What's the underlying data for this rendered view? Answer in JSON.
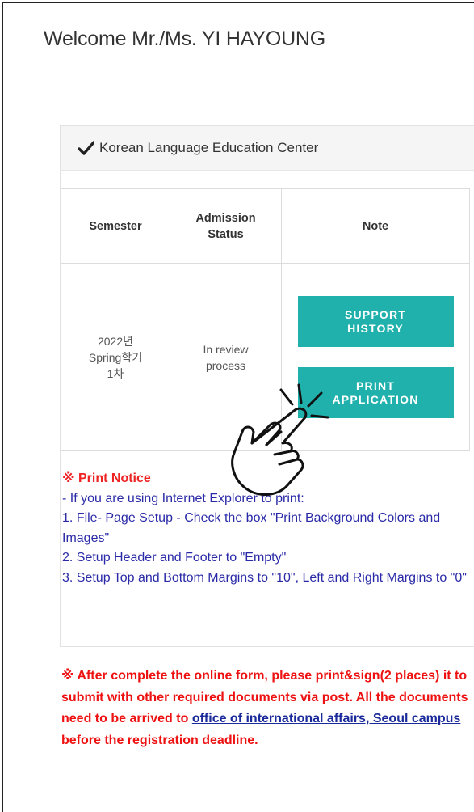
{
  "welcome": "Welcome Mr./Ms. YI HAYOUNG",
  "panel": {
    "title": "Korean Language Education Center",
    "icon": "check-icon"
  },
  "table": {
    "headers": [
      "Semester",
      "Admission Status",
      "Note"
    ],
    "rows": [
      {
        "semester": "2022년 Spring학기 1차",
        "status": "In review process",
        "buttons": [
          "SUPPORT HISTORY",
          "PRINT APPLICATION"
        ]
      }
    ]
  },
  "notice": {
    "title": "※ Print Notice",
    "lines": [
      "- If you are using Internet Explorer to print:",
      "1. File- Page Setup - Check the box \"Print Background Colors and Images\"",
      "2. Setup Header and Footer to \"Empty\"",
      "3. Setup Top and Bottom Margins to \"10\", Left and Right Margins to \"0\""
    ]
  },
  "warning": {
    "before": "※ After complete the online form, please print&sign(2 places) it to submit with other required documents via post. All the documents need to be arrived to ",
    "link": "office of international affairs, Seoul campus",
    "after": " before the registration deadline."
  },
  "colors": {
    "button": "#20b1ad",
    "notice_title": "#e22222",
    "notice_text": "#2a2aa8",
    "warning": "#e11111"
  },
  "overlay": {
    "icon": "pointing-hand-icon"
  }
}
